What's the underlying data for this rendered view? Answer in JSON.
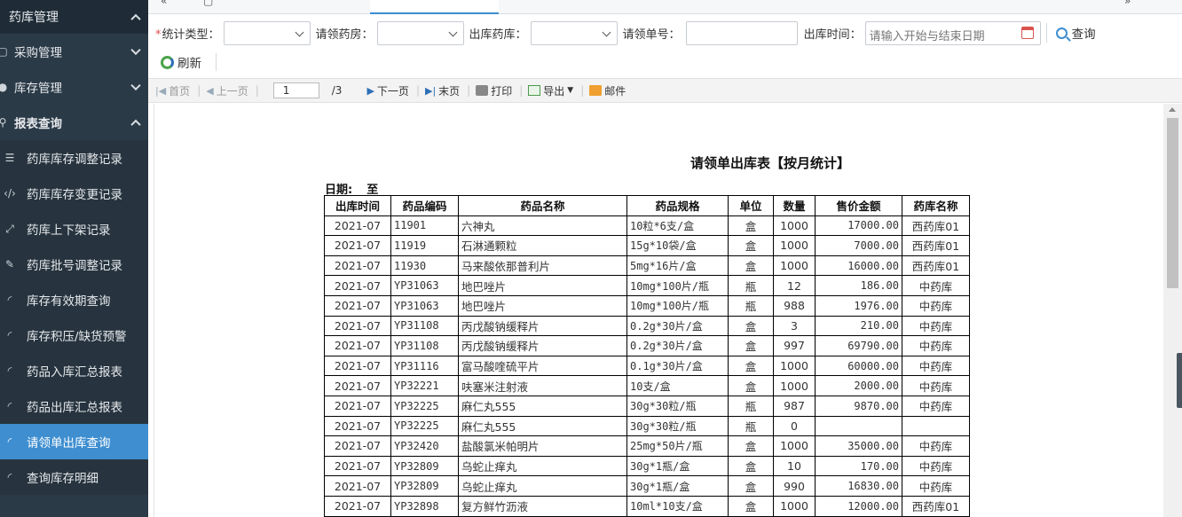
{
  "sidebar": {
    "header": "药库管理",
    "sections": [
      {
        "label": "采购管理",
        "icon": "cart-icon"
      },
      {
        "label": "库存管理",
        "icon": "circle-icon"
      },
      {
        "label": "报表查询",
        "icon": "search-icon"
      }
    ],
    "items": [
      {
        "label": "药库库存调整记录",
        "icon": "sliders-icon"
      },
      {
        "label": "药库库存变更记录",
        "icon": "code-icon"
      },
      {
        "label": "药库上下架记录",
        "icon": "expand-icon"
      },
      {
        "label": "药库批号调整记录",
        "icon": "edit-icon"
      },
      {
        "label": "库存有效期查询",
        "icon": "rss-icon"
      },
      {
        "label": "库存积压/缺货预警",
        "icon": "rss-icon"
      },
      {
        "label": "药品入库汇总报表",
        "icon": "rss-icon"
      },
      {
        "label": "药品出库汇总报表",
        "icon": "rss-icon"
      },
      {
        "label": "请领单出库查询",
        "icon": "rss-icon"
      },
      {
        "label": "查询库存明细",
        "icon": "rss-icon"
      }
    ]
  },
  "filters": {
    "stat_type_label": "统计类型：",
    "pharmacy_label": "请领药房：",
    "warehouse_label": "出库药库：",
    "order_no_label": "请领单号：",
    "time_label": "出库时间：",
    "time_placeholder": "请输入开始与结束日期",
    "query_button": "查询",
    "refresh_button": "刷新"
  },
  "pager": {
    "first": "首页",
    "prev": "上一页",
    "page": "1",
    "total": "/3",
    "next": "下一页",
    "last": "末页",
    "print": "打印",
    "export": "导出",
    "mail": "邮件"
  },
  "report": {
    "title": "请领单出库表【按月统计】",
    "date_label": "日期:",
    "date_to": "至",
    "columns": [
      "出库时间",
      "药品编码",
      "药品名称",
      "药品规格",
      "单位",
      "数量",
      "售价金额",
      "药库名称"
    ],
    "rows": [
      [
        "2021-07",
        "11901",
        "六神丸",
        "10粒*6支/盒",
        "盒",
        "1000",
        "17000.00",
        "西药库01"
      ],
      [
        "2021-07",
        "11919",
        "石淋通颗粒",
        "15g*10袋/盒",
        "盒",
        "1000",
        "7000.00",
        "西药库01"
      ],
      [
        "2021-07",
        "11930",
        "马来酸依那普利片",
        "5mg*16片/盒",
        "盒",
        "1000",
        "16000.00",
        "西药库01"
      ],
      [
        "2021-07",
        "YP31063",
        "地巴唑片",
        "10mg*100片/瓶",
        "瓶",
        "12",
        "186.00",
        "中药库"
      ],
      [
        "2021-07",
        "YP31063",
        "地巴唑片",
        "10mg*100片/瓶",
        "瓶",
        "988",
        "1976.00",
        "中药库"
      ],
      [
        "2021-07",
        "YP31108",
        "丙戊酸钠缓释片",
        "0.2g*30片/盒",
        "盒",
        "3",
        "210.00",
        "中药库"
      ],
      [
        "2021-07",
        "YP31108",
        "丙戊酸钠缓释片",
        "0.2g*30片/盒",
        "盒",
        "997",
        "69790.00",
        "中药库"
      ],
      [
        "2021-07",
        "YP31116",
        "富马酸喹硫平片",
        "0.1g*30片/盒",
        "盒",
        "1000",
        "60000.00",
        "中药库"
      ],
      [
        "2021-07",
        "YP32221",
        "呋塞米注射液",
        "10支/盒",
        "盒",
        "1000",
        "2000.00",
        "中药库"
      ],
      [
        "2021-07",
        "YP32225",
        "麻仁丸555",
        "30g*30粒/瓶",
        "瓶",
        "987",
        "9870.00",
        "中药库"
      ],
      [
        "2021-07",
        "YP32225",
        "麻仁丸555",
        "30g*30粒/瓶",
        "瓶",
        "0",
        "",
        ""
      ],
      [
        "2021-07",
        "YP32420",
        "盐酸氯米帕明片",
        "25mg*50片/瓶",
        "盒",
        "1000",
        "35000.00",
        "中药库"
      ],
      [
        "2021-07",
        "YP32809",
        "乌蛇止痒丸",
        "30g*1瓶/盒",
        "盒",
        "10",
        "170.00",
        "中药库"
      ],
      [
        "2021-07",
        "YP32809",
        "乌蛇止痒丸",
        "30g*1瓶/盒",
        "盒",
        "990",
        "16830.00",
        "中药库"
      ],
      [
        "2021-07",
        "YP32898",
        "复方鲜竹沥液",
        "10ml*10支/盒",
        "盒",
        "1000",
        "12000.00",
        "西药库01"
      ]
    ]
  }
}
